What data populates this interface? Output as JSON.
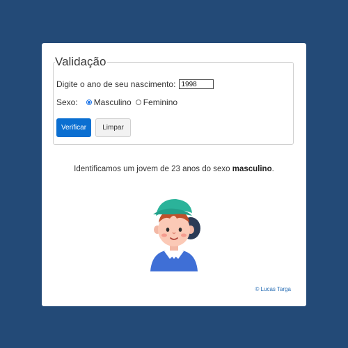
{
  "form": {
    "legend": "Validação",
    "birth_year_label": "Digite o ano de seu nascimento:",
    "birth_year_value": "1998",
    "sex_label": "Sexo:",
    "options": [
      {
        "label": "Masculino",
        "checked": true
      },
      {
        "label": "Feminino",
        "checked": false
      }
    ],
    "verify_label": "Verificar",
    "clear_label": "Limpar"
  },
  "result": {
    "text_prefix": "Identificamos um jovem de 23 anos do sexo ",
    "text_bold": "masculino",
    "text_suffix": "."
  },
  "avatar": {
    "icon": "boy-with-cap-avatar"
  },
  "footer": {
    "credit": "© Lucas Targa"
  },
  "colors": {
    "background": "#234a77",
    "primary": "#0b6fd1",
    "link": "#2a6fb5"
  }
}
